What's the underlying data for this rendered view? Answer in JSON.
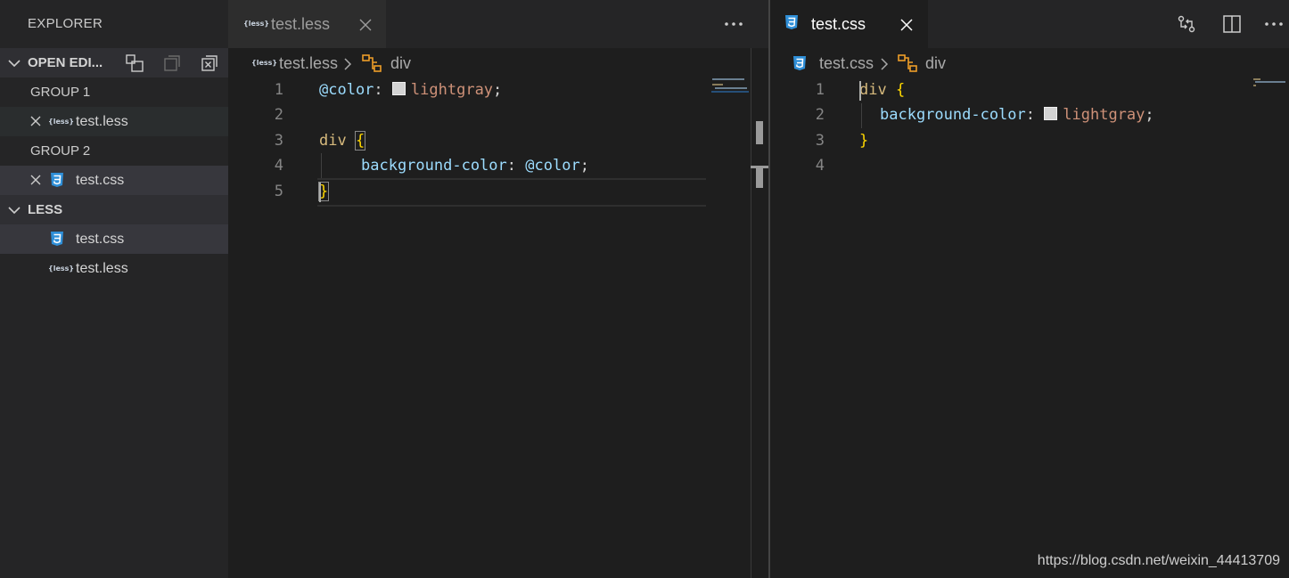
{
  "explorer": {
    "title": "EXPLORER",
    "open_editors": {
      "label": "OPEN EDI...",
      "groups": [
        {
          "label": "GROUP 1",
          "files": [
            {
              "name": "test.less",
              "type": "less"
            }
          ]
        },
        {
          "label": "GROUP 2",
          "files": [
            {
              "name": "test.css",
              "type": "css"
            }
          ]
        }
      ]
    },
    "folder": {
      "label": "LESS",
      "files": [
        {
          "name": "test.css",
          "type": "css"
        },
        {
          "name": "test.less",
          "type": "less"
        }
      ]
    }
  },
  "left_editor": {
    "tab": {
      "name": "test.less",
      "type": "less"
    },
    "breadcrumb": {
      "file": "test.less",
      "symbol": "div"
    },
    "line_numbers": [
      "1",
      "2",
      "3",
      "4",
      "5"
    ],
    "lines": [
      {
        "var": "@color",
        "colon": ":",
        "swatch": "#d3d3d3",
        "value": "lightgray",
        "semi": ";"
      },
      {},
      {
        "selector": "div",
        "brace": "{"
      },
      {
        "prop": "background-color",
        "colon": ":",
        "value_var": "@color",
        "semi": ";"
      },
      {
        "brace": "}"
      }
    ]
  },
  "right_editor": {
    "tab": {
      "name": "test.css",
      "type": "css"
    },
    "breadcrumb": {
      "file": "test.css",
      "symbol": "div"
    },
    "line_numbers": [
      "1",
      "2",
      "3",
      "4"
    ],
    "lines": [
      {
        "selector": "div",
        "brace": "{"
      },
      {
        "prop": "background-color",
        "colon": ":",
        "swatch": "#d3d3d3",
        "value": "lightgray",
        "semi": ";"
      },
      {
        "brace": "}"
      },
      {}
    ]
  },
  "watermark": "https://blog.csdn.net/weixin_44413709",
  "icons": {
    "less_badge": "{less}",
    "css_badge": "css3-icon",
    "close": "close-icon",
    "more": "more-icon",
    "split": "split-editor-icon",
    "compare": "compare-changes-icon",
    "symbol": "symbol-structure-icon"
  }
}
